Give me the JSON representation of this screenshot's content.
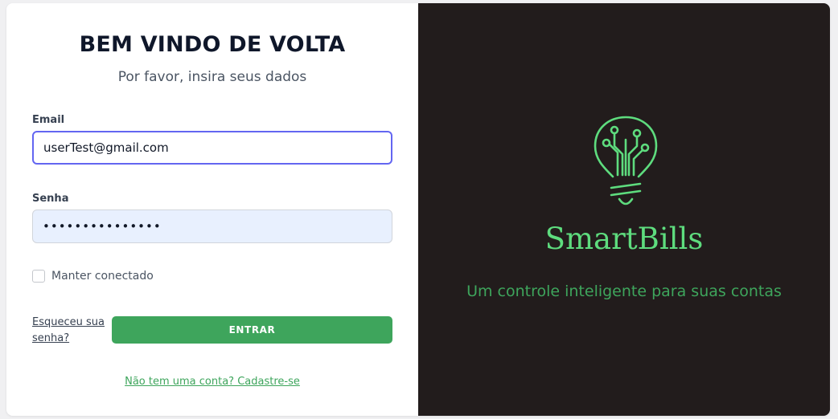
{
  "login": {
    "title": "BEM VINDO DE VOLTA",
    "subtitle": "Por favor, insira seus dados",
    "email_label": "Email",
    "email_value": "userTest@gmail.com",
    "password_label": "Senha",
    "password_value": "•••••••••••••••",
    "remember_label": "Manter conectado",
    "remember_checked": false,
    "forgot_label": "Esqueceu sua senha?",
    "submit_label": "ENTRAR",
    "signup_label": "Não tem uma conta? Cadastre-se"
  },
  "brand": {
    "name": "SmartBills",
    "tagline": "Um controle inteligente para suas contas",
    "logo_icon": "lightbulb-circuit-icon",
    "colors": {
      "accent": "#3ea55c",
      "brand_text": "#5edc7e",
      "panel_bg": "#221c1c",
      "focus": "#6366f1"
    }
  }
}
